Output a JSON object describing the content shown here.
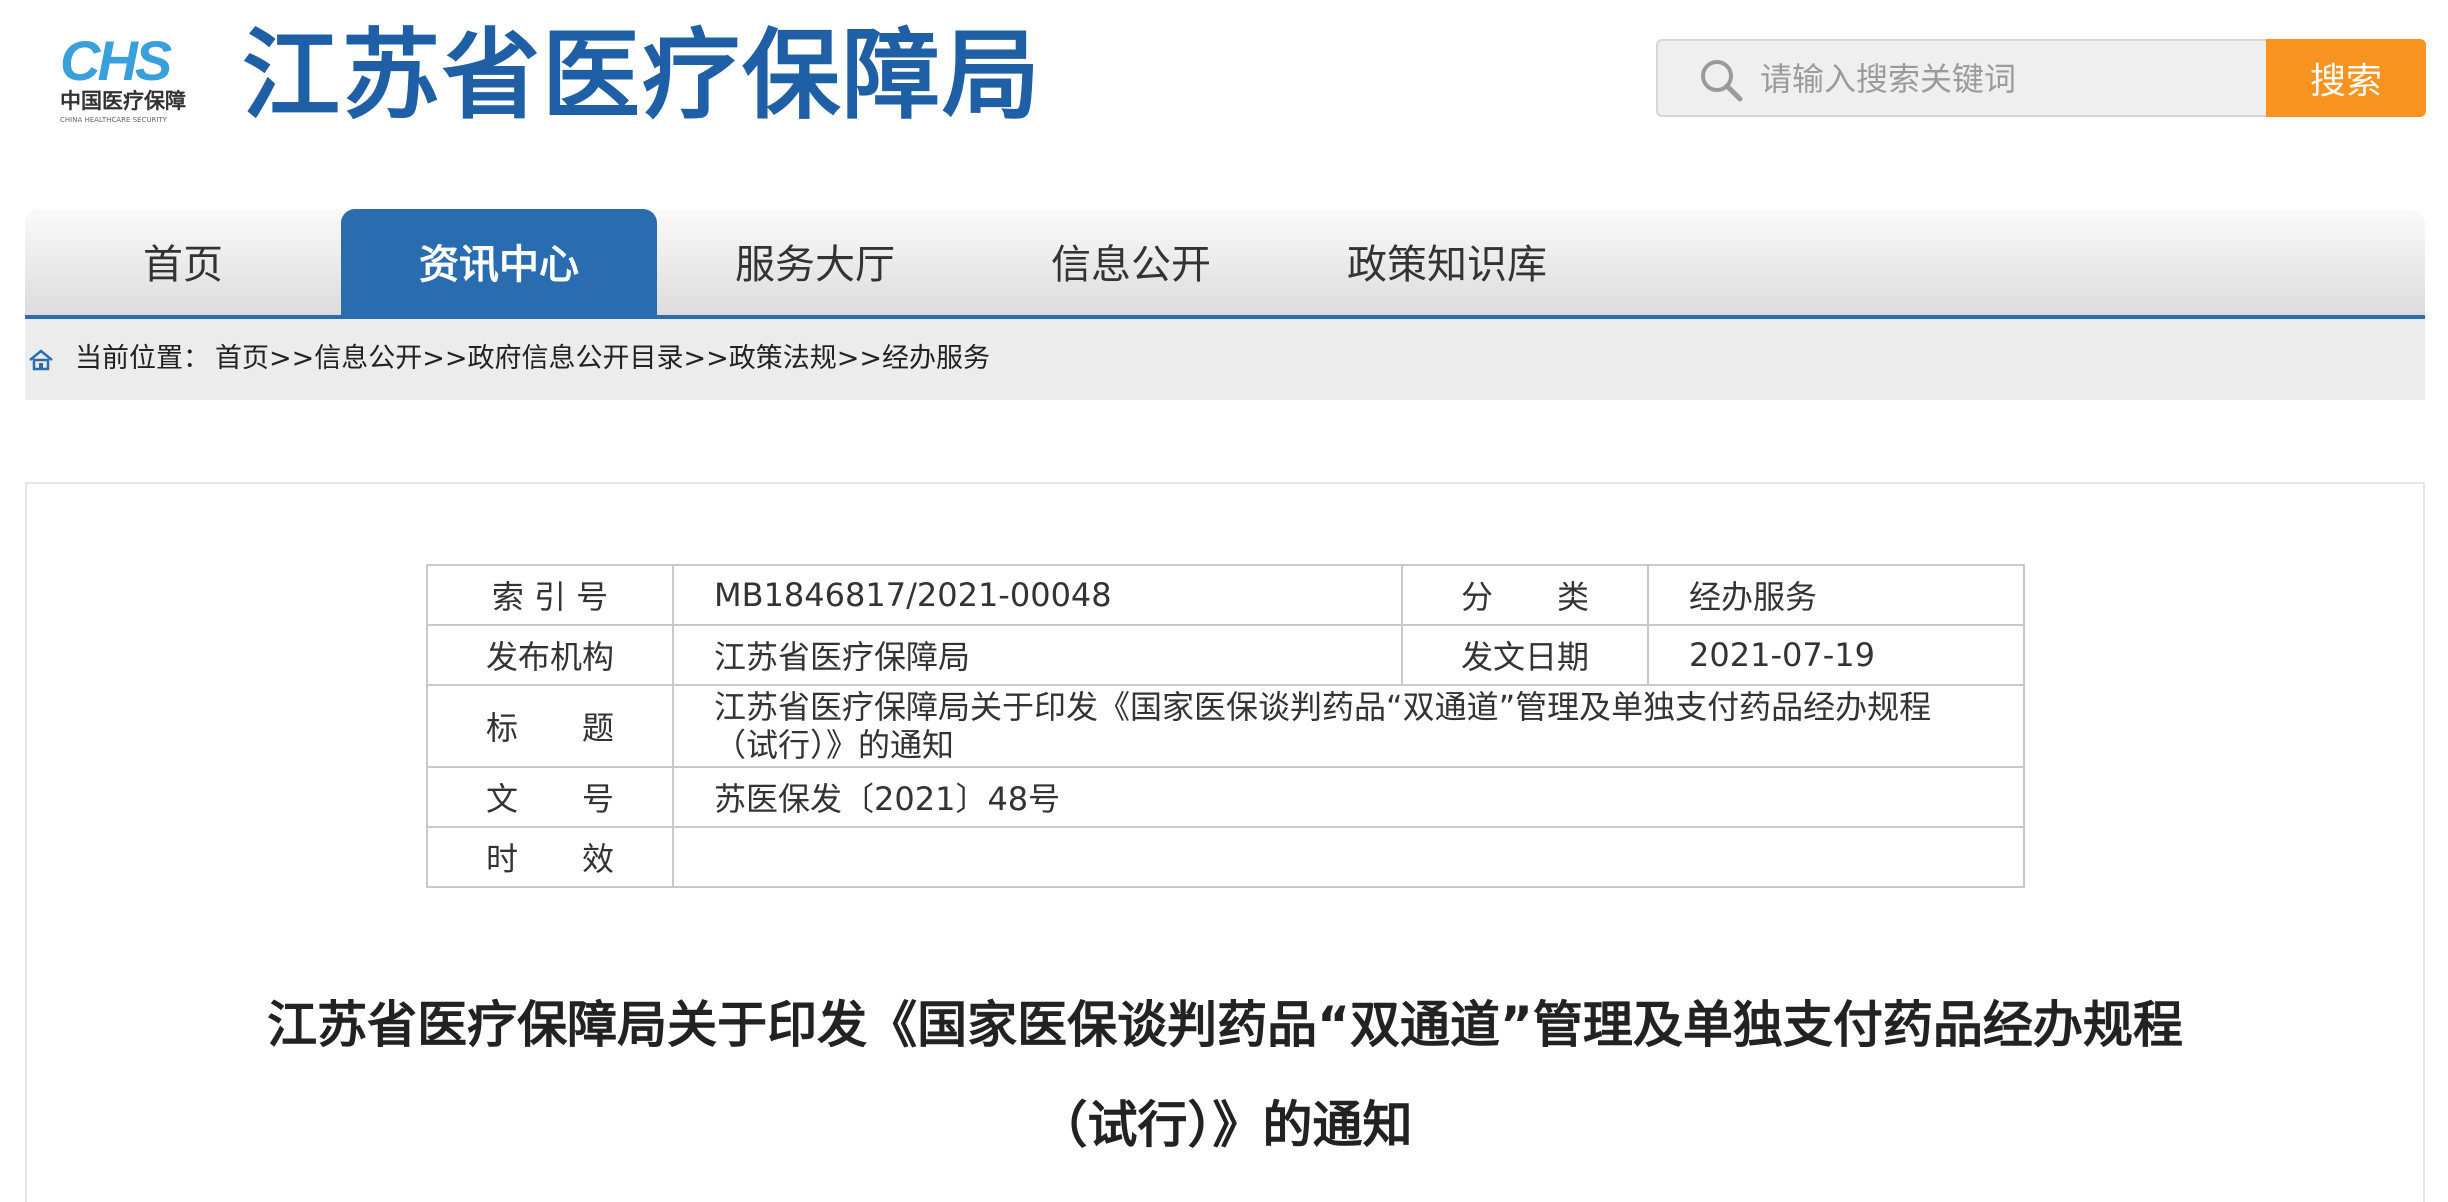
{
  "header": {
    "logo": {
      "mark": "CHS",
      "cn": "中国医疗保障",
      "en": "CHINA HEALTHCARE SECURITY"
    },
    "site_title": "江苏省医疗保障局",
    "search": {
      "placeholder": "请输入搜索关键词",
      "button_label": "搜索"
    }
  },
  "nav": {
    "items": [
      "首页",
      "资讯中心",
      "服务大厅",
      "信息公开",
      "政策知识库"
    ],
    "active_index": 1
  },
  "breadcrumb": {
    "label": "当前位置：",
    "items": [
      "首页",
      "信息公开",
      "政府信息公开目录",
      "政策法规",
      "经办服务"
    ],
    "separator": ">>"
  },
  "meta_table": {
    "index_label": "索 引 号",
    "index_value": "MB1846817/2021-00048",
    "category_label": "分　　类",
    "category_value": "经办服务",
    "publisher_label": "发布机构",
    "publisher_value": "江苏省医疗保障局",
    "date_label": "发文日期",
    "date_value": "2021-07-19",
    "title_label": "标　　题",
    "title_value": "江苏省医疗保障局关于印发《国家医保谈判药品“双通道”管理及单独支付药品经办规程（试行）》的通知",
    "doc_no_label": "文　　号",
    "doc_no_value": "苏医保发〔2021〕48号",
    "validity_label": "时　　效",
    "validity_value": ""
  },
  "document": {
    "title_line1": "江苏省医疗保障局关于印发《国家医保谈判药品“双通道”管理及单独支付药品经办规程",
    "title_line2": "（试行）》的通知"
  },
  "colors": {
    "brand_blue": "#2a6cb0",
    "search_orange": "#f7931e"
  }
}
